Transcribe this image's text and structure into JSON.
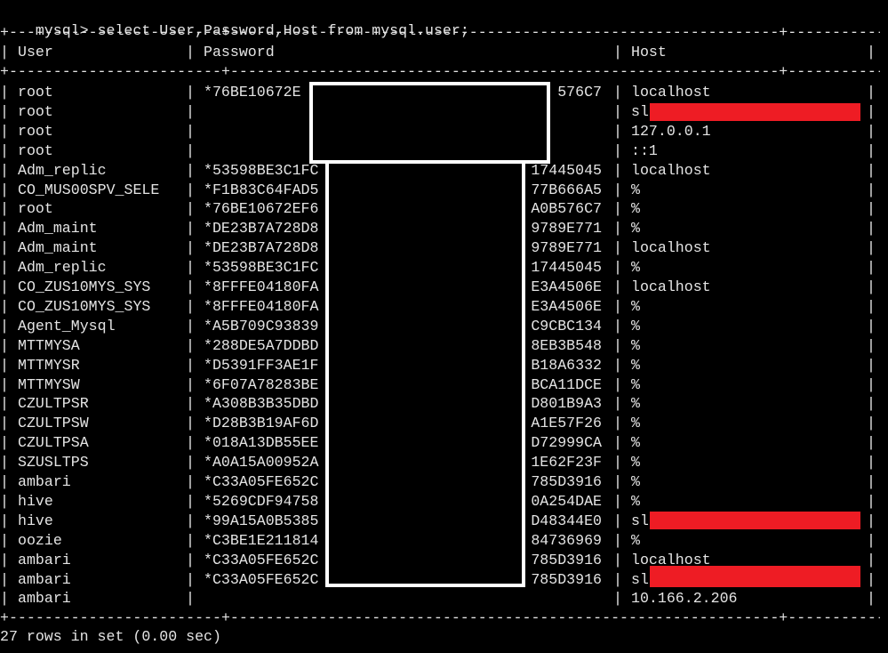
{
  "prompt": "mysql>",
  "command": "select User,Password,Host from mysql.user;",
  "divider": "+------------------------+--------------------------------------------------------------+------------------------------------+",
  "columns": [
    "User",
    "Password",
    "Host"
  ],
  "rows": [
    {
      "user": "root",
      "password": "*76BE10672E",
      "password_end": "576C7",
      "host": "localhost"
    },
    {
      "user": "root",
      "password": "",
      "password_end": "",
      "host": "sl"
    },
    {
      "user": "root",
      "password": "",
      "password_end": "",
      "host": "127.0.0.1"
    },
    {
      "user": "root",
      "password": "",
      "password_end": "",
      "host": "::1"
    },
    {
      "user": "Adm_replic",
      "password": "*53598BE3C1FC",
      "password_end": "17445045",
      "host": "localhost"
    },
    {
      "user": "CO_MUS00SPV_SELE",
      "password": "*F1B83C64FAD5",
      "password_end": "77B666A5",
      "host": "%"
    },
    {
      "user": "root",
      "password": "*76BE10672EF6",
      "password_end": "A0B576C7",
      "host": "%"
    },
    {
      "user": "Adm_maint",
      "password": "*DE23B7A728D8",
      "password_end": "9789E771",
      "host": "%"
    },
    {
      "user": "Adm_maint",
      "password": "*DE23B7A728D8",
      "password_end": "9789E771",
      "host": "localhost"
    },
    {
      "user": "Adm_replic",
      "password": "*53598BE3C1FC",
      "password_end": "17445045",
      "host": "%"
    },
    {
      "user": "CO_ZUS10MYS_SYS",
      "password": "*8FFFE04180FA",
      "password_end": "E3A4506E",
      "host": "localhost"
    },
    {
      "user": "CO_ZUS10MYS_SYS",
      "password": "*8FFFE04180FA",
      "password_end": "E3A4506E",
      "host": "%"
    },
    {
      "user": "Agent_Mysql",
      "password": "*A5B709C93839",
      "password_end": "C9CBC134",
      "host": "%"
    },
    {
      "user": "MTTMYSA",
      "password": "*288DE5A7DDBD",
      "password_end": "8EB3B548",
      "host": "%"
    },
    {
      "user": "MTTMYSR",
      "password": "*D5391FF3AE1F",
      "password_end": "B18A6332",
      "host": "%"
    },
    {
      "user": "MTTMYSW",
      "password": "*6F07A78283BE",
      "password_end": "BCA11DCE",
      "host": "%"
    },
    {
      "user": "CZULTPSR",
      "password": "*A308B3B35DBD",
      "password_end": "D801B9A3",
      "host": "%"
    },
    {
      "user": "CZULTPSW",
      "password": "*D28B3B19AF6D",
      "password_end": "A1E57F26",
      "host": "%"
    },
    {
      "user": "CZULTPSA",
      "password": "*018A13DB55EE",
      "password_end": "D72999CA",
      "host": "%"
    },
    {
      "user": "SZUSLTPS",
      "password": "*A0A15A00952A",
      "password_end": "1E62F23F",
      "host": "%"
    },
    {
      "user": "ambari",
      "password": "*C33A05FE652C",
      "password_end": "785D3916",
      "host": "%"
    },
    {
      "user": "hive",
      "password": "*5269CDF94758",
      "password_end": "0A254DAE",
      "host": "%"
    },
    {
      "user": "hive",
      "password": "*99A15A0B5385",
      "password_end": "D48344E0",
      "host": "sl"
    },
    {
      "user": "oozie",
      "password": "*C3BE1E211814",
      "password_end": "84736969",
      "host": "%"
    },
    {
      "user": "ambari",
      "password": "*C33A05FE652C",
      "password_end": "785D3916",
      "host": "localhost"
    },
    {
      "user": "ambari",
      "password": "*C33A05FE652C",
      "password_end": "785D3916",
      "host": "sl"
    },
    {
      "user": "ambari",
      "password": "",
      "password_end": "",
      "host": "10.166.2.206"
    }
  ],
  "footer": "27 rows in set (0.00 sec)",
  "colors": {
    "background": "#000000",
    "text": "#e4e4e4",
    "redaction_box": "#000000",
    "redaction_border": "#ffffff",
    "redaction_red": "#ee1c24"
  }
}
